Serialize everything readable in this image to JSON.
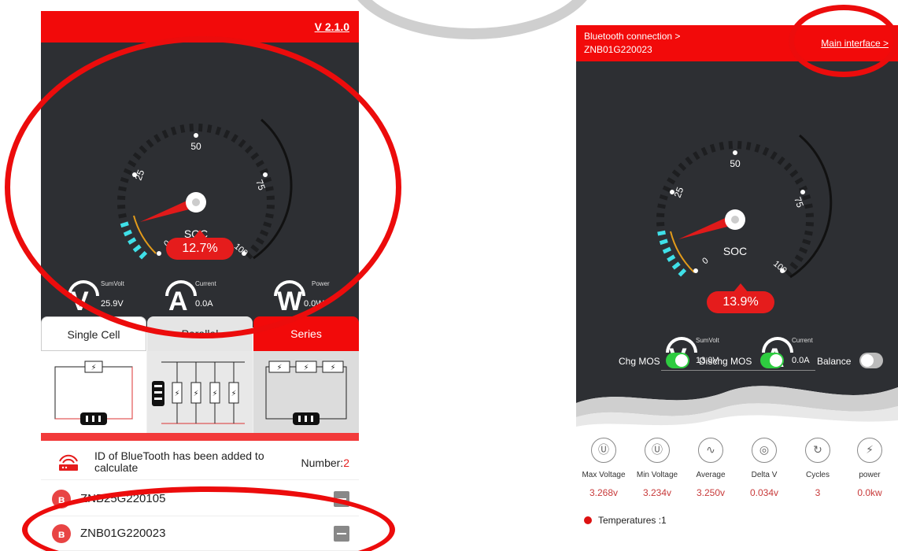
{
  "left_phone": {
    "version": "V 2.1.0",
    "gauge": {
      "ticks": [
        "0",
        "25",
        "50",
        "75",
        "100"
      ],
      "center_label": "SOC",
      "soc_value": "12.7%",
      "soc_fraction": 0.127
    },
    "meters": [
      {
        "letter": "V",
        "label": "SumVolt",
        "value": "25.9V"
      },
      {
        "letter": "A",
        "label": "Current",
        "value": "0.0A"
      },
      {
        "letter": "W",
        "label": "Power",
        "value": "0.0W"
      }
    ],
    "tabs": [
      "Single Cell",
      "Parallel",
      "Series"
    ],
    "bt_id_text": "ID of BlueTooth has been added to calculate",
    "number_label": "Number:",
    "number_value": "2",
    "devices": [
      "ZNB25G220105",
      "ZNB01G220023"
    ]
  },
  "right_phone": {
    "bluetooth_connection": "Bluetooth connection >",
    "device_id": "ZNB01G220023",
    "main_interface": "Main interface >",
    "gauge": {
      "ticks": [
        "0",
        "25",
        "50",
        "75",
        "100"
      ],
      "center_label": "SOC",
      "soc_value": "13.9%",
      "soc_fraction": 0.139
    },
    "meters": [
      {
        "letter": "V",
        "label": "SumVolt",
        "value": "13.0V"
      },
      {
        "letter": "A",
        "label": "Current",
        "value": "0.0A"
      }
    ],
    "switches": [
      {
        "label": "Chg MOS",
        "on": true
      },
      {
        "label": "Dischg MOS",
        "on": true
      },
      {
        "label": "Balance",
        "on": false
      }
    ],
    "stats": [
      {
        "label": "Max Voltage",
        "value": "3.268v",
        "icon": "max-voltage-icon"
      },
      {
        "label": "Min Voltage",
        "value": "3.234v",
        "icon": "min-voltage-icon"
      },
      {
        "label": "Average",
        "value": "3.250v",
        "icon": "average-icon"
      },
      {
        "label": "Delta V",
        "value": "0.034v",
        "icon": "delta-v-icon"
      },
      {
        "label": "Cycles",
        "value": "3",
        "icon": "cycles-icon"
      },
      {
        "label": "power",
        "value": "0.0kw",
        "icon": "power-icon"
      }
    ],
    "temperatures": "Temperatures :1"
  },
  "colors": {
    "brand_red": "#f20a0a",
    "dark_panel": "#2d2f33",
    "gauge_cyan": "#3fe0e8",
    "toggle_green": "#2ecc40",
    "value_red": "#c83a3a"
  }
}
